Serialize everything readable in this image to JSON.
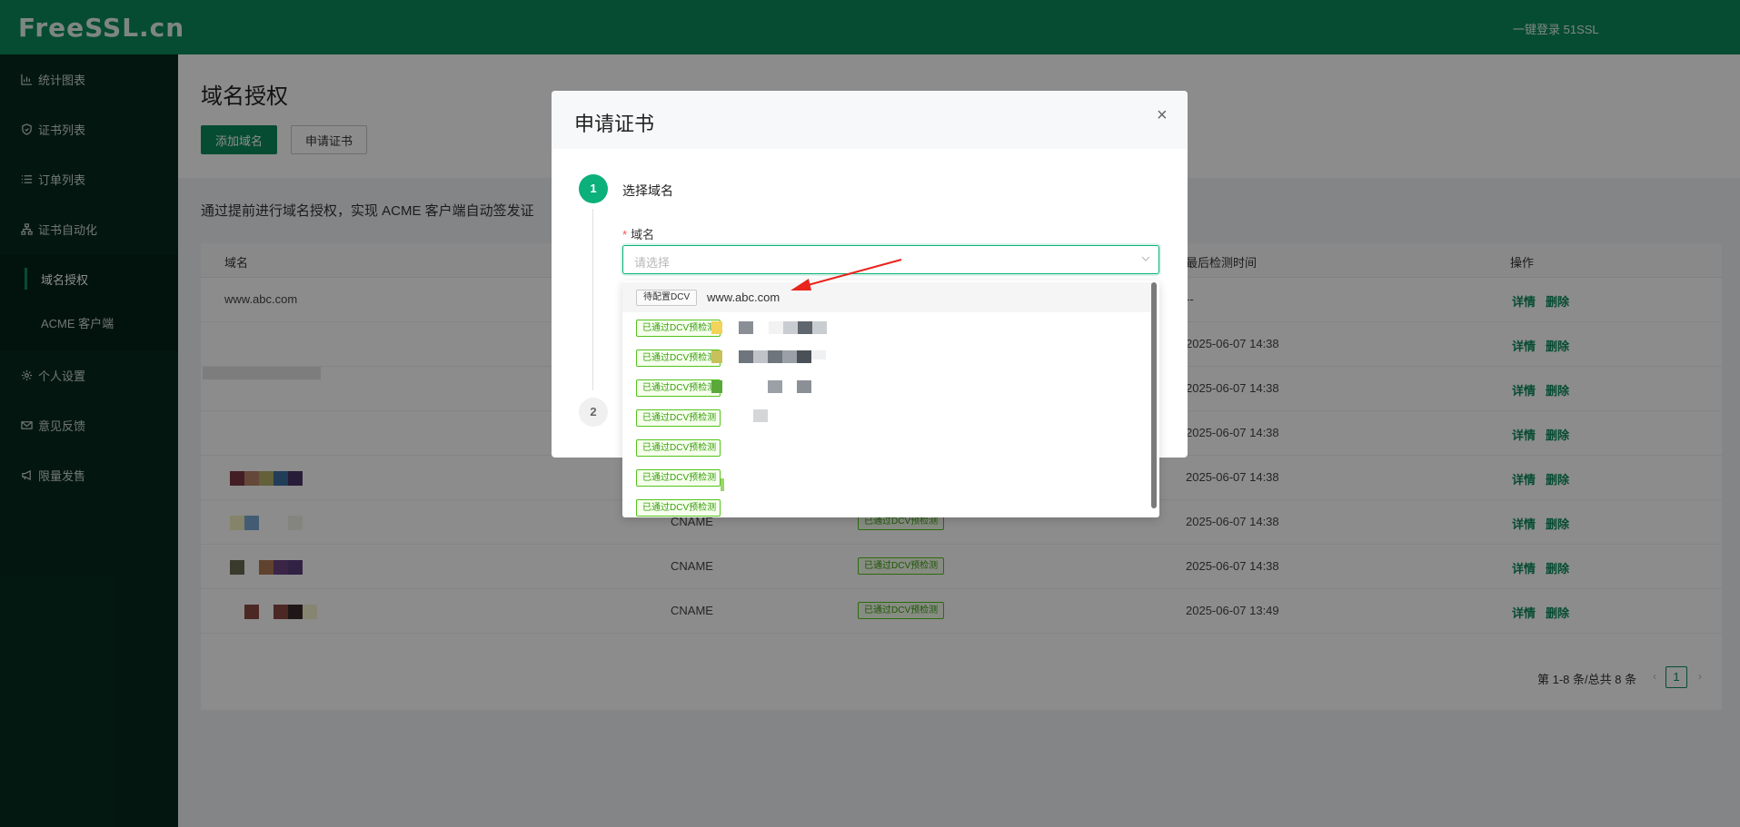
{
  "app": {
    "logo": "FreeSSL.cn",
    "top_link": "一键登录 51SSL"
  },
  "sidebar": {
    "items": [
      {
        "label": "统计图表",
        "icon": "chart-icon"
      },
      {
        "label": "证书列表",
        "icon": "shield-icon"
      },
      {
        "label": "订单列表",
        "icon": "list-icon"
      },
      {
        "label": "证书自动化",
        "icon": "sitemap-icon"
      },
      {
        "label": "个人设置",
        "icon": "gear-icon"
      },
      {
        "label": "意见反馈",
        "icon": "mail-icon"
      },
      {
        "label": "限量发售",
        "icon": "megaphone-icon"
      }
    ],
    "subitems": [
      {
        "label": "域名授权",
        "active": true
      },
      {
        "label": "ACME 客户端",
        "active": false
      }
    ]
  },
  "page": {
    "title": "域名授权",
    "add_button": "添加域名",
    "apply_button": "申请证书",
    "description": "通过提前进行域名授权，实现 ACME 客户端自动签发证"
  },
  "table": {
    "columns": {
      "domain": "域名",
      "last_check": "最后检测时间",
      "actions": "操作"
    },
    "rows": [
      {
        "domain": "www.abc.com",
        "type": "",
        "status": "",
        "time": "--"
      },
      {
        "domain": "",
        "type": "",
        "status": "",
        "time": "2025-06-07 14:38"
      },
      {
        "domain": "",
        "type": "",
        "status": "",
        "time": "2025-06-07 14:38"
      },
      {
        "domain": "",
        "type": "",
        "status": "",
        "time": "2025-06-07 14:38"
      },
      {
        "domain": "",
        "type": "",
        "status": "",
        "time": "2025-06-07 14:38"
      },
      {
        "domain": "",
        "type": "CNAME",
        "status": "已通过DCV预检测",
        "time": "2025-06-07 14:38"
      },
      {
        "domain": "",
        "type": "CNAME",
        "status": "已通过DCV预检测",
        "time": "2025-06-07 14:38"
      },
      {
        "domain": "",
        "type": "CNAME",
        "status": "已通过DCV预检测",
        "time": "2025-06-07 13:49"
      }
    ],
    "action_detail": "详情",
    "action_delete": "删除",
    "pagination": {
      "summary": "第 1-8 条/总共 8 条",
      "current_page": "1",
      "prev": "‹",
      "next": "›"
    }
  },
  "modal": {
    "title": "申请证书",
    "close": "×",
    "steps": [
      {
        "number": "1",
        "title": "选择域名"
      },
      {
        "number": "2",
        "title": ""
      }
    ],
    "field_label": "域名",
    "required_mark": "*",
    "select_placeholder": "请选择",
    "options": [
      {
        "tag": "待配置DCV",
        "text": "www.abc.com",
        "highlighted": true
      },
      {
        "tag": "已通过DCV预检测",
        "text": ""
      },
      {
        "tag": "已通过DCV预检测",
        "text": ""
      },
      {
        "tag": "已通过DCV预检测",
        "text": ""
      },
      {
        "tag": "已通过DCV预检测",
        "text": ""
      },
      {
        "tag": "已通过DCV预检测",
        "text": ""
      },
      {
        "tag": "已通过DCV预检测",
        "text": ""
      },
      {
        "tag": "已通过DCV预检测",
        "text": ""
      }
    ]
  },
  "colors": {
    "brand": "#0c8a5c",
    "sidebar": "#062b1e",
    "step_active": "#0cb07a",
    "annotation_arrow": "#e8241c"
  }
}
